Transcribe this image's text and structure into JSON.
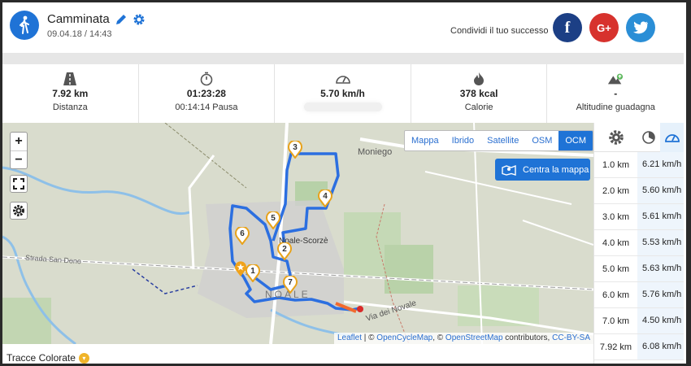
{
  "activity": {
    "title": "Camminata",
    "datetime": "09.04.18 / 14:43",
    "icon": "walking-icon"
  },
  "share": {
    "label": "Condividi il tuo successo",
    "facebook": "f",
    "googleplus": "G+",
    "twitter_icon": "twitter-bird-icon"
  },
  "stats": [
    {
      "icon": "road-icon",
      "value": "7.92 km",
      "label": "Distanza"
    },
    {
      "icon": "stopwatch-icon",
      "value": "01:23:28",
      "label": "00:14:14 Pausa"
    },
    {
      "icon": "speedometer-icon",
      "value": "5.70 km/h",
      "label": ""
    },
    {
      "icon": "flame-icon",
      "value": "378 kcal",
      "label": "Calorie"
    },
    {
      "icon": "altitude-icon",
      "value": "-",
      "label": "Altitudine guadagna"
    }
  ],
  "map": {
    "zoom_in": "+",
    "zoom_out": "−",
    "layers": [
      "Mappa",
      "Ibrido",
      "Satellite",
      "OSM",
      "OCM"
    ],
    "active_layer": "OCM",
    "center_button": "Centra la mappa",
    "labels": {
      "town1": "Moniego",
      "town2": "Noale-Scorzè",
      "town3": "NOALE",
      "road1": "Strada San Dono",
      "road2": "Via dei Novale"
    },
    "markers": [
      "1",
      "2",
      "3",
      "4",
      "5",
      "6",
      "7"
    ],
    "attribution": {
      "leaflet": "Leaflet",
      "sep1": " | © ",
      "ocm": "OpenCycleMap",
      "sep2": ", © ",
      "osm": "OpenStreetMap",
      "mid": " contributors, ",
      "license": "CC-BY-SA"
    },
    "route_color": "#2c6fe0"
  },
  "splits": {
    "rows": [
      {
        "km": "1.0 km",
        "speed": "6.21 km/h"
      },
      {
        "km": "2.0 km",
        "speed": "5.60 km/h"
      },
      {
        "km": "3.0 km",
        "speed": "5.61 km/h"
      },
      {
        "km": "4.0 km",
        "speed": "5.53 km/h"
      },
      {
        "km": "5.0 km",
        "speed": "5.63 km/h"
      },
      {
        "km": "6.0 km",
        "speed": "5.76 km/h"
      },
      {
        "km": "7.0 km",
        "speed": "4.50 km/h"
      },
      {
        "km": "7.92 km",
        "speed": "6.08 km/h"
      }
    ]
  },
  "legend": {
    "label": "Tracce Colorate",
    "icon": "chevron-down-icon"
  },
  "colors": {
    "accent": "#1f73d6",
    "facebook": "#1c3f85",
    "googleplus": "#d7322d",
    "twitter": "#2a8ed6"
  }
}
